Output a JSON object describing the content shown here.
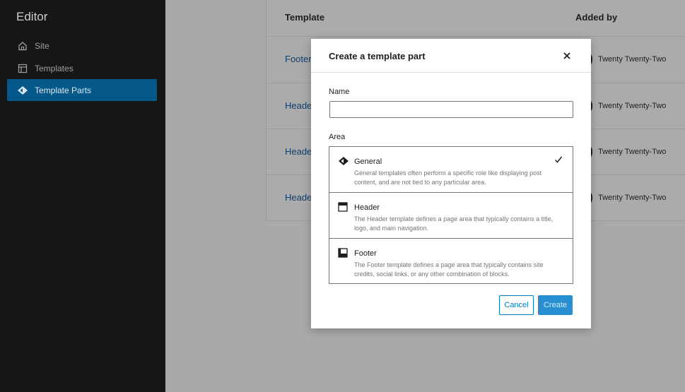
{
  "sidebar": {
    "title": "Editor",
    "items": [
      {
        "label": "Site",
        "icon": "home-icon",
        "active": false
      },
      {
        "label": "Templates",
        "icon": "layout-icon",
        "active": false
      },
      {
        "label": "Template Parts",
        "icon": "diamond-icon",
        "active": true
      }
    ]
  },
  "table": {
    "headers": {
      "template": "Template",
      "added_by": "Added by"
    },
    "rows": [
      {
        "template": "Footer",
        "added_by": "Twenty Twenty-Two"
      },
      {
        "template": "Header",
        "added_by": "Twenty Twenty-Two"
      },
      {
        "template": "Header",
        "added_by": "Twenty Twenty-Two"
      },
      {
        "template": "Header",
        "added_by": "Twenty Twenty-Two"
      }
    ]
  },
  "modal": {
    "title": "Create a template part",
    "close_icon": "close-icon",
    "name_label": "Name",
    "name_value": "",
    "area_label": "Area",
    "areas": [
      {
        "title": "General",
        "description": "General templates often perform a specific role like displaying post content, and are not tied to any particular area.",
        "icon": "diamond-icon",
        "selected": true
      },
      {
        "title": "Header",
        "description": "The Header template defines a page area that typically contains a title, logo, and main navigation.",
        "icon": "header-layout-icon",
        "selected": false
      },
      {
        "title": "Footer",
        "description": "The Footer template defines a page area that typically contains site credits, social links, or any other combination of blocks.",
        "icon": "footer-layout-icon",
        "selected": false
      }
    ],
    "cancel_label": "Cancel",
    "create_label": "Create"
  },
  "colors": {
    "accent": "#007cba",
    "sidebar_bg": "#161616",
    "active_item_bg": "#04598a",
    "overlay": "#a7a7a7"
  }
}
